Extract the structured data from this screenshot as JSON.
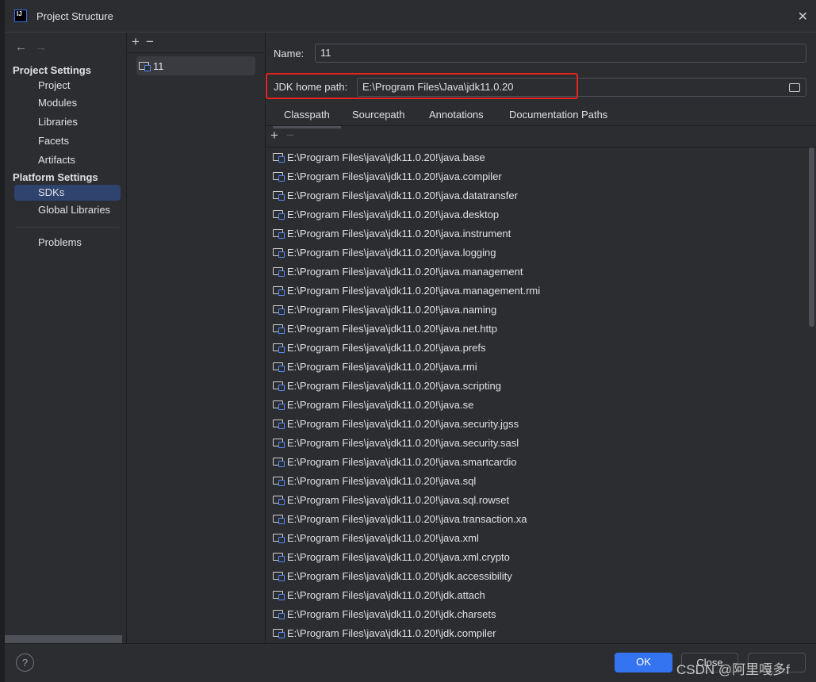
{
  "window": {
    "title": "Project Structure",
    "logo": "IJ"
  },
  "sidebar": {
    "project_settings": "Project Settings",
    "platform_settings": "Platform Settings",
    "items": [
      {
        "label": "Project"
      },
      {
        "label": "Modules"
      },
      {
        "label": "Libraries"
      },
      {
        "label": "Facets"
      },
      {
        "label": "Artifacts"
      },
      {
        "label": "SDKs",
        "selected": true
      },
      {
        "label": "Global Libraries"
      },
      {
        "label": "Problems"
      }
    ]
  },
  "sdks": {
    "items": [
      {
        "label": "11"
      }
    ]
  },
  "form": {
    "name_label": "Name:",
    "name_value": "11",
    "jdk_label": "JDK home path:",
    "jdk_value": "E:\\Program Files\\Java\\jdk11.0.20"
  },
  "tabs": [
    {
      "label": "Classpath",
      "active": true
    },
    {
      "label": "Sourcepath"
    },
    {
      "label": "Annotations"
    },
    {
      "label": "Documentation Paths"
    }
  ],
  "classpath": [
    "E:\\Program Files\\java\\jdk11.0.20!\\java.base",
    "E:\\Program Files\\java\\jdk11.0.20!\\java.compiler",
    "E:\\Program Files\\java\\jdk11.0.20!\\java.datatransfer",
    "E:\\Program Files\\java\\jdk11.0.20!\\java.desktop",
    "E:\\Program Files\\java\\jdk11.0.20!\\java.instrument",
    "E:\\Program Files\\java\\jdk11.0.20!\\java.logging",
    "E:\\Program Files\\java\\jdk11.0.20!\\java.management",
    "E:\\Program Files\\java\\jdk11.0.20!\\java.management.rmi",
    "E:\\Program Files\\java\\jdk11.0.20!\\java.naming",
    "E:\\Program Files\\java\\jdk11.0.20!\\java.net.http",
    "E:\\Program Files\\java\\jdk11.0.20!\\java.prefs",
    "E:\\Program Files\\java\\jdk11.0.20!\\java.rmi",
    "E:\\Program Files\\java\\jdk11.0.20!\\java.scripting",
    "E:\\Program Files\\java\\jdk11.0.20!\\java.se",
    "E:\\Program Files\\java\\jdk11.0.20!\\java.security.jgss",
    "E:\\Program Files\\java\\jdk11.0.20!\\java.security.sasl",
    "E:\\Program Files\\java\\jdk11.0.20!\\java.smartcardio",
    "E:\\Program Files\\java\\jdk11.0.20!\\java.sql",
    "E:\\Program Files\\java\\jdk11.0.20!\\java.sql.rowset",
    "E:\\Program Files\\java\\jdk11.0.20!\\java.transaction.xa",
    "E:\\Program Files\\java\\jdk11.0.20!\\java.xml",
    "E:\\Program Files\\java\\jdk11.0.20!\\java.xml.crypto",
    "E:\\Program Files\\java\\jdk11.0.20!\\jdk.accessibility",
    "E:\\Program Files\\java\\jdk11.0.20!\\jdk.attach",
    "E:\\Program Files\\java\\jdk11.0.20!\\jdk.charsets",
    "E:\\Program Files\\java\\jdk11.0.20!\\jdk.compiler"
  ],
  "footer": {
    "help": "?",
    "ok": "OK",
    "close": "Close"
  },
  "watermark": "CSDN @阿里嘎多f",
  "colors": {
    "accent": "#3574f0",
    "selection": "#2e436e",
    "highlight_box": "#e5231f"
  }
}
